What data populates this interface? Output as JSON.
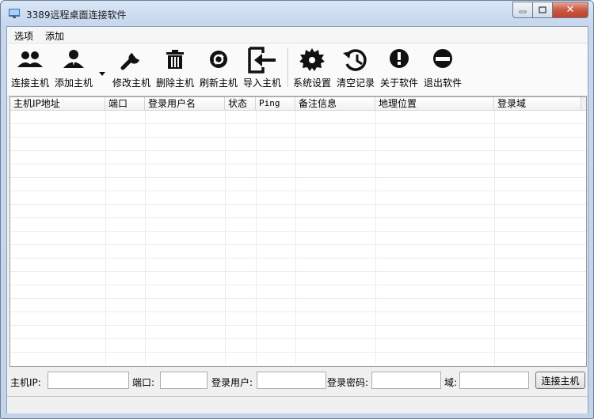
{
  "window": {
    "title": "3389远程桌面连接软件",
    "min_icon": "minimize-icon",
    "max_icon": "maximize-icon",
    "close_glyph": "✕"
  },
  "menu": {
    "items": [
      "选项",
      "添加"
    ]
  },
  "toolbar": {
    "buttons": [
      {
        "label": "连接主机",
        "icon": "users-icon"
      },
      {
        "label": "添加主机",
        "icon": "user-add-icon"
      },
      {
        "label": "修改主机",
        "icon": "wrench-icon"
      },
      {
        "label": "删除主机",
        "icon": "trash-icon"
      },
      {
        "label": "刷新主机",
        "icon": "refresh-icon"
      },
      {
        "label": "导入主机",
        "icon": "import-icon"
      },
      {
        "label": "系统设置",
        "icon": "gear-icon"
      },
      {
        "label": "清空记录",
        "icon": "history-icon"
      },
      {
        "label": "关于软件",
        "icon": "info-icon"
      },
      {
        "label": "退出软件",
        "icon": "exit-icon"
      }
    ]
  },
  "table": {
    "columns": [
      "主机IP地址",
      "端口",
      "登录用户名",
      "状态",
      "Ping",
      "备注信息",
      "地理位置",
      "登录域"
    ],
    "rows": []
  },
  "form": {
    "ip_label": "主机IP:",
    "ip_value": "",
    "port_label": "端口:",
    "port_value": "",
    "user_label": "登录用户:",
    "user_value": "",
    "password_label": "登录密码:",
    "password_value": "",
    "domain_label": "域:",
    "domain_value": "",
    "connect_label": "连接主机"
  },
  "colors": {
    "title_bar": "#c6d7ee",
    "close_button": "#c8502f",
    "icon": "#111111"
  }
}
